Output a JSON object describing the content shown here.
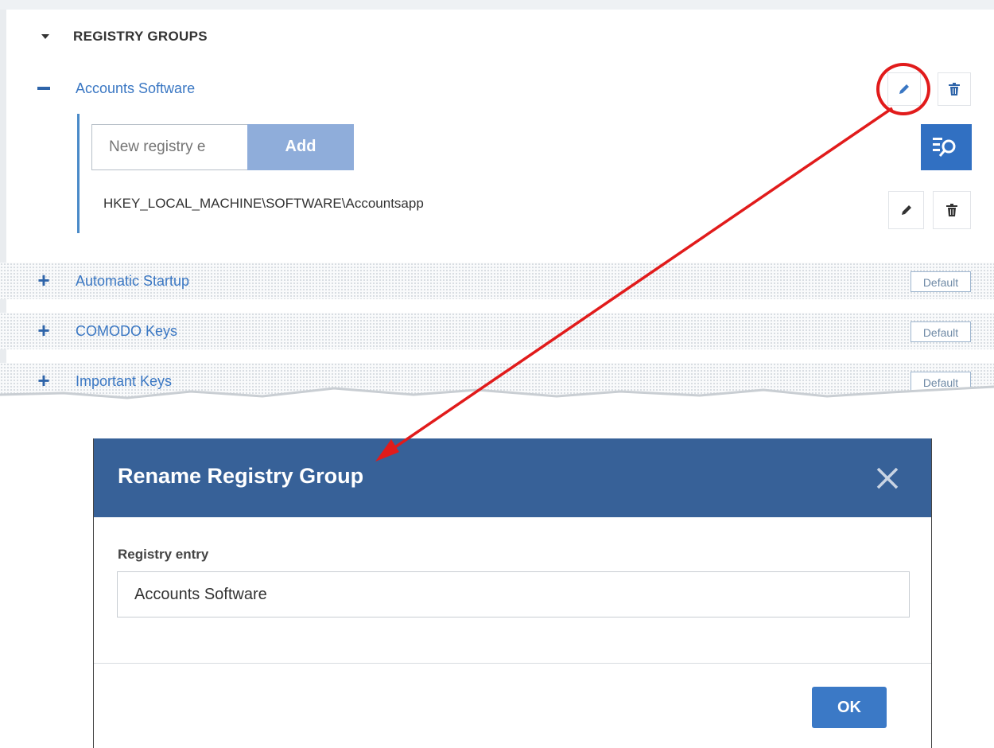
{
  "registry_panel": {
    "section_title": "REGISTRY GROUPS",
    "expanded_group": {
      "label": "Accounts Software",
      "new_entry_placeholder": "New registry e",
      "add_label": "Add",
      "entry_path": "HKEY_LOCAL_MACHINE\\SOFTWARE\\Accountsapp"
    },
    "groups": [
      {
        "label": "Automatic Startup",
        "badge": "Default"
      },
      {
        "label": "COMODO Keys",
        "badge": "Default"
      },
      {
        "label": "Important Keys",
        "badge": "Default"
      }
    ],
    "icons": {
      "expand": "caret-down-icon",
      "collapse": "minus-icon",
      "expand_group": "plus-icon",
      "edit": "pencil-icon",
      "delete": "trash-icon",
      "search": "search-list-icon"
    }
  },
  "dialog": {
    "title": "Rename Registry Group",
    "field_label": "Registry entry",
    "field_value": "Accounts Software",
    "ok_label": "OK"
  },
  "colors": {
    "accent": "#3170c2",
    "header": "#376198",
    "link": "#3a77c3",
    "annotation": "#e11b1b"
  }
}
